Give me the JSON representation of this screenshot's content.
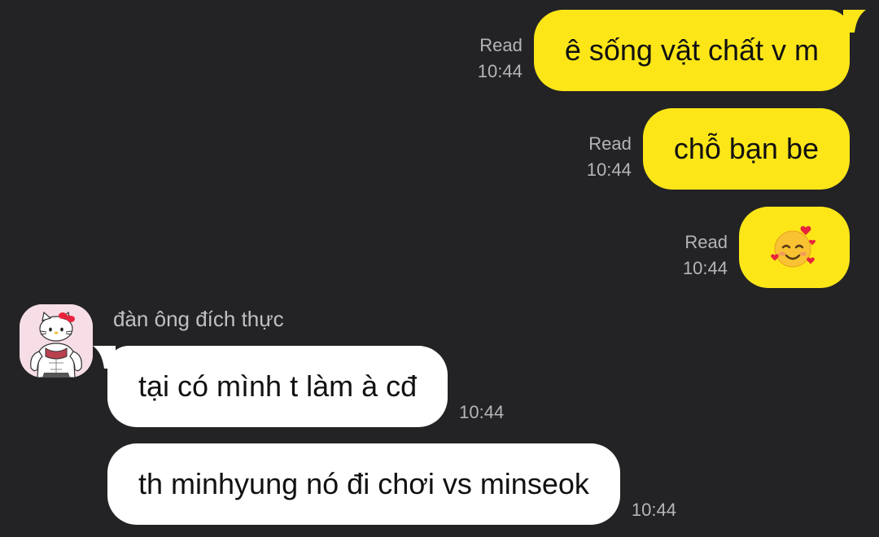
{
  "conversation": {
    "outgoing": [
      {
        "text": "ê sống vật chất v m",
        "status": "Read",
        "time": "10:44"
      },
      {
        "text": "chỗ bạn be",
        "status": "Read",
        "time": "10:44"
      },
      {
        "emoji": "smiling-face-with-hearts",
        "status": "Read",
        "time": "10:44"
      }
    ],
    "incoming": {
      "sender": "đàn ông đích thực",
      "avatar": "hello-kitty-bodybuilder-avatar",
      "messages": [
        {
          "text": "tại có mình t làm à cđ",
          "time": "10:44"
        },
        {
          "text": "th minhyung nó đi chơi vs minseok",
          "time": "10:44"
        }
      ]
    }
  },
  "colors": {
    "background": "#232325",
    "outgoing_bubble": "#fde618",
    "incoming_bubble": "#ffffff",
    "meta_text": "#b5b5b8"
  }
}
